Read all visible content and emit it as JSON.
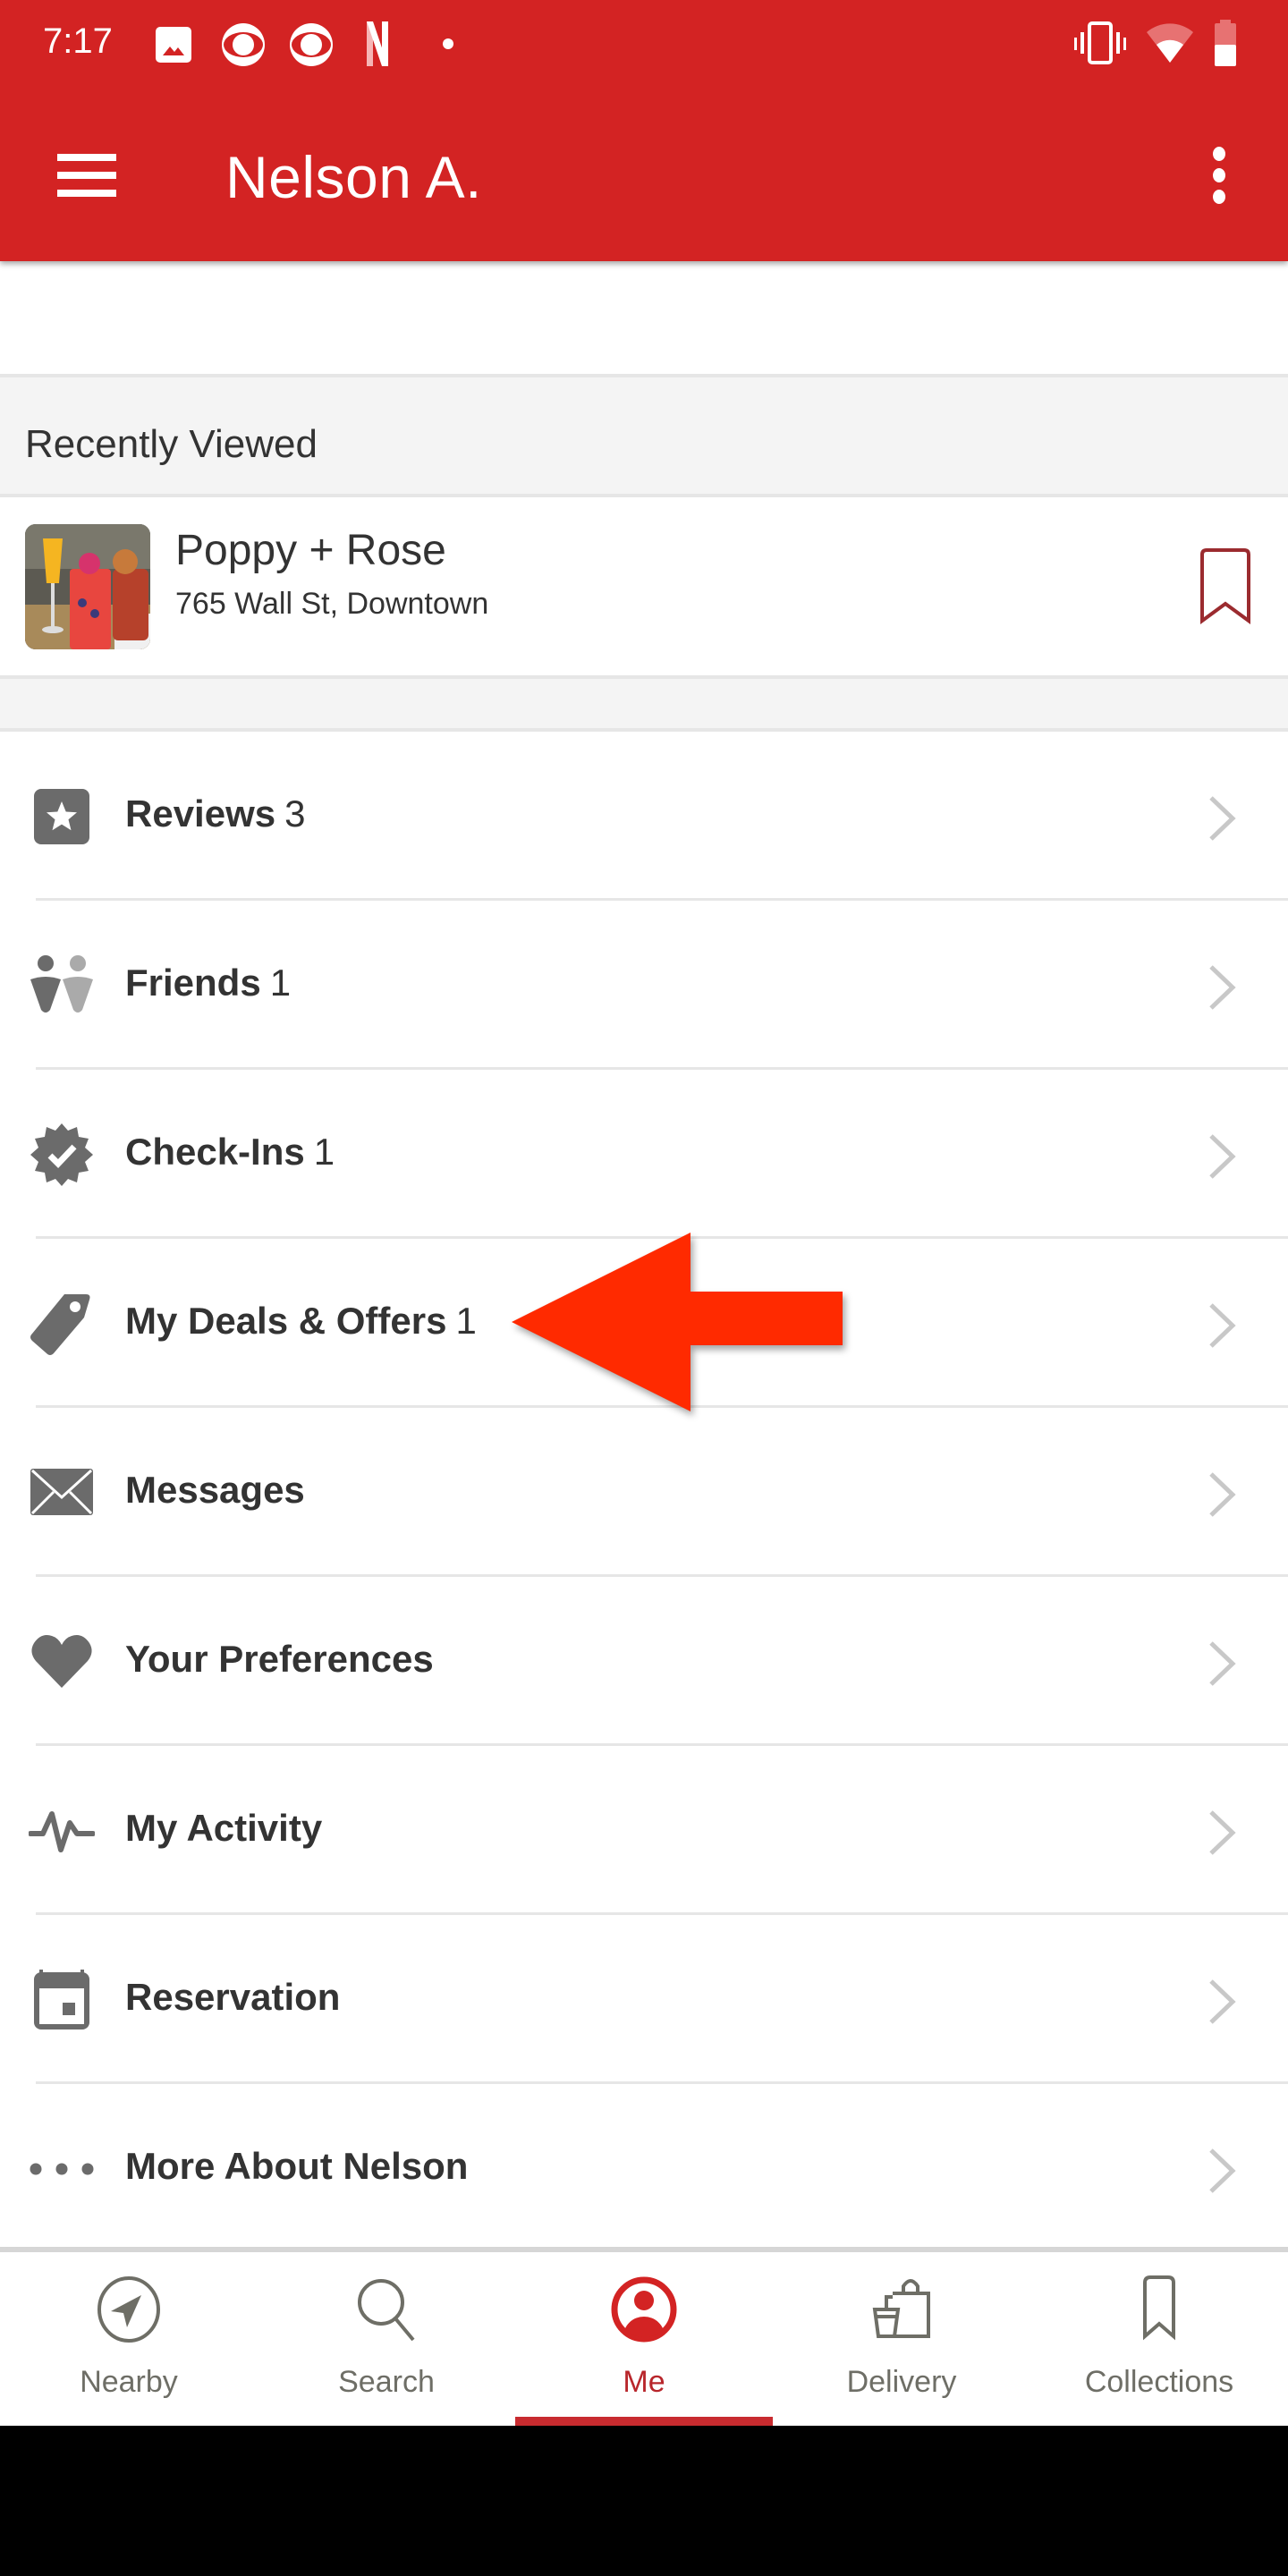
{
  "status_bar": {
    "time": "7:17",
    "left_icons": [
      "image-notification-icon",
      "cbs-icon",
      "cbs-icon",
      "netflix-icon",
      "dot-icon"
    ],
    "right_icons": [
      "vibrate-icon",
      "wifi-icon",
      "battery-icon"
    ]
  },
  "header": {
    "title": "Nelson A.",
    "menu_icon": "hamburger-menu-icon",
    "overflow_icon": "more-vert-icon"
  },
  "recently_viewed": {
    "title": "Recently Viewed",
    "items": [
      {
        "name": "Poppy + Rose",
        "address": "765 Wall St, Downtown",
        "bookmark_icon": "bookmark-outline-icon"
      }
    ]
  },
  "menu": {
    "items": [
      {
        "label": "Reviews",
        "count": "3",
        "icon": "star-icon"
      },
      {
        "label": "Friends",
        "count": "1",
        "icon": "friends-icon"
      },
      {
        "label": "Check-Ins",
        "count": "1",
        "icon": "check-badge-icon"
      },
      {
        "label": "My Deals & Offers",
        "count": "1",
        "icon": "tag-icon"
      },
      {
        "label": "Messages",
        "count": "",
        "icon": "envelope-icon"
      },
      {
        "label": "Your Preferences",
        "count": "",
        "icon": "heart-icon"
      },
      {
        "label": "My Activity",
        "count": "",
        "icon": "activity-icon"
      },
      {
        "label": "Reservation",
        "count": "",
        "icon": "calendar-icon"
      },
      {
        "label": "More About Nelson",
        "count": "",
        "icon": "more-horiz-icon"
      }
    ]
  },
  "annotation": {
    "type": "arrow",
    "points_to": "My Deals & Offers",
    "color": "#ff2a00"
  },
  "bottom_nav": {
    "tabs": [
      {
        "label": "Nearby",
        "icon": "navigation-icon",
        "active": false
      },
      {
        "label": "Search",
        "icon": "search-icon",
        "active": false
      },
      {
        "label": "Me",
        "icon": "profile-icon",
        "active": true
      },
      {
        "label": "Delivery",
        "icon": "delivery-icon",
        "active": false
      },
      {
        "label": "Collections",
        "icon": "bookmark-icon",
        "active": false
      }
    ]
  },
  "colors": {
    "brand_red": "#d32323",
    "active_tab": "#c82b2f",
    "icon_gray": "#6b6b6b",
    "text_dark": "#333333",
    "background_gray": "#f4f4f4"
  }
}
